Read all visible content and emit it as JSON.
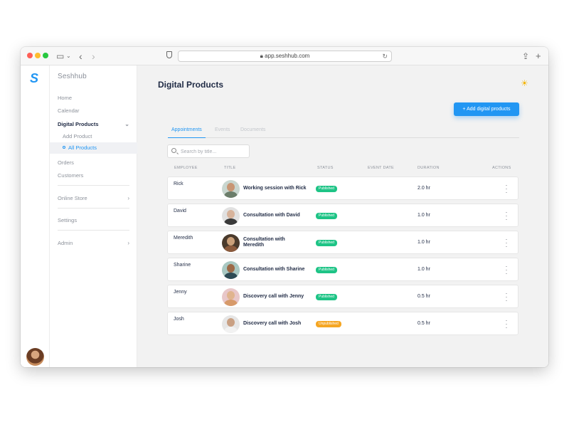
{
  "browser": {
    "url": "app.seshhub.com"
  },
  "app": {
    "brand": "Seshhub"
  },
  "sidebar": {
    "items": [
      {
        "label": "Home"
      },
      {
        "label": "Calendar"
      },
      {
        "label": "Digital Products"
      },
      {
        "label": "Add Product"
      },
      {
        "label": "All Products"
      },
      {
        "label": "Orders"
      },
      {
        "label": "Customers"
      },
      {
        "label": "Online Store"
      },
      {
        "label": "Settings"
      },
      {
        "label": "Admin"
      }
    ]
  },
  "main": {
    "title": "Digital Products",
    "add_button": "+ Add digital products",
    "tabs": [
      {
        "label": "Appointments"
      },
      {
        "label": "Events"
      },
      {
        "label": "Documents"
      }
    ],
    "search_placeholder": "Search by title...",
    "columns": [
      "EMPLOYEE",
      "TITLE",
      "STATUS",
      "EVENT DATE",
      "DURATION",
      "ACTIONS"
    ],
    "rows": [
      {
        "employee": "Rick",
        "title": "Working session with Rick",
        "status": "Published",
        "duration": "2.0 hr"
      },
      {
        "employee": "David",
        "title": "Consultation with David",
        "status": "Published",
        "duration": "1.0 hr"
      },
      {
        "employee": "Meredith",
        "title": "Consultation with Meredith",
        "status": "Published",
        "duration": "1.0 hr"
      },
      {
        "employee": "Sharine",
        "title": "Consultation with Sharine",
        "status": "Published",
        "duration": "1.0 hr"
      },
      {
        "employee": "Jenny",
        "title": "Discovery call with Jenny",
        "status": "Published",
        "duration": "0.5 hr"
      },
      {
        "employee": "Josh",
        "title": "Discovery call with Josh",
        "status": "Unpublished",
        "duration": "0.5 hr"
      }
    ]
  },
  "colors": {
    "accent": "#2196f3",
    "published": "#1ec486",
    "unpublished": "#f5a623"
  }
}
